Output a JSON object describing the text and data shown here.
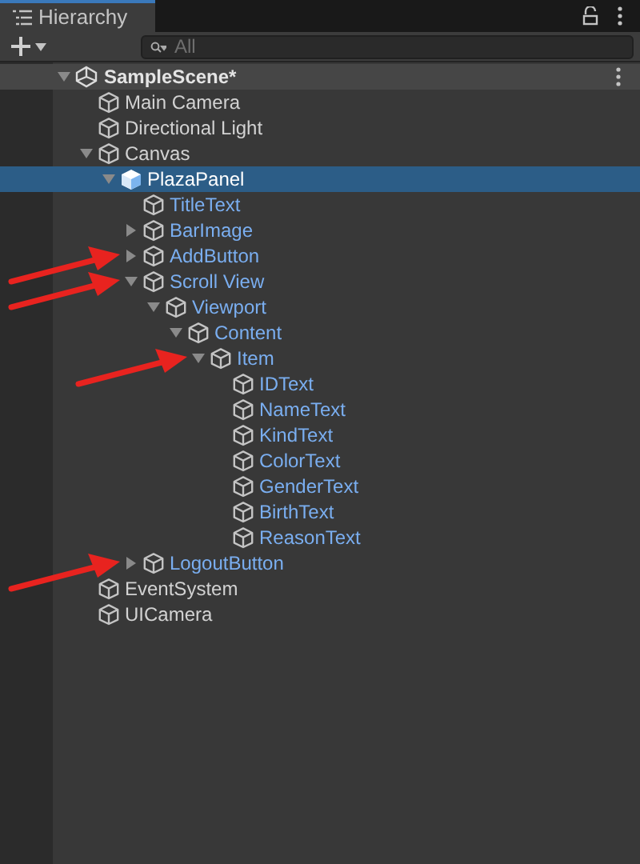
{
  "tab": {
    "title": "Hierarchy"
  },
  "search": {
    "placeholder": "All"
  },
  "scene": {
    "name": "SampleScene*",
    "expanded": true,
    "children": [
      {
        "name": "Main Camera",
        "kind": "object",
        "selected": false,
        "marked": false
      },
      {
        "name": "Directional Light",
        "kind": "object",
        "selected": false,
        "marked": false
      },
      {
        "name": "Canvas",
        "kind": "object",
        "selected": false,
        "marked": false,
        "expanded": true,
        "children": [
          {
            "name": "PlazaPanel",
            "kind": "prefab-root",
            "selected": true,
            "marked": false,
            "expanded": true,
            "children": [
              {
                "name": "TitleText",
                "kind": "prefab-child",
                "selected": false,
                "marked": false
              },
              {
                "name": "BarImage",
                "kind": "prefab-child",
                "selected": false,
                "marked": false,
                "expanded": false
              },
              {
                "name": "AddButton",
                "kind": "prefab-child",
                "selected": false,
                "marked": true,
                "expanded": false
              },
              {
                "name": "Scroll View",
                "kind": "prefab-child",
                "selected": false,
                "marked": true,
                "expanded": true,
                "children": [
                  {
                    "name": "Viewport",
                    "kind": "prefab-child",
                    "selected": false,
                    "marked": false,
                    "expanded": true,
                    "children": [
                      {
                        "name": "Content",
                        "kind": "prefab-child",
                        "selected": false,
                        "marked": false,
                        "expanded": true,
                        "children": [
                          {
                            "name": "Item",
                            "kind": "prefab-child",
                            "selected": false,
                            "marked": true,
                            "expanded": true,
                            "children": [
                              {
                                "name": "IDText",
                                "kind": "prefab-child",
                                "selected": false,
                                "marked": false
                              },
                              {
                                "name": "NameText",
                                "kind": "prefab-child",
                                "selected": false,
                                "marked": false
                              },
                              {
                                "name": "KindText",
                                "kind": "prefab-child",
                                "selected": false,
                                "marked": false
                              },
                              {
                                "name": "ColorText",
                                "kind": "prefab-child",
                                "selected": false,
                                "marked": false
                              },
                              {
                                "name": "GenderText",
                                "kind": "prefab-child",
                                "selected": false,
                                "marked": false
                              },
                              {
                                "name": "BirthText",
                                "kind": "prefab-child",
                                "selected": false,
                                "marked": false
                              },
                              {
                                "name": "ReasonText",
                                "kind": "prefab-child",
                                "selected": false,
                                "marked": false
                              }
                            ]
                          }
                        ]
                      }
                    ]
                  }
                ]
              },
              {
                "name": "LogoutButton",
                "kind": "prefab-child",
                "selected": false,
                "marked": true,
                "expanded": false
              }
            ]
          }
        ]
      },
      {
        "name": "EventSystem",
        "kind": "object",
        "selected": false,
        "marked": false
      },
      {
        "name": "UICamera",
        "kind": "object",
        "selected": false,
        "marked": false
      }
    ]
  }
}
